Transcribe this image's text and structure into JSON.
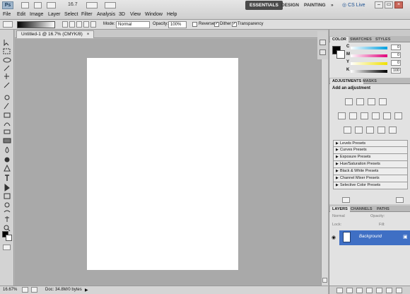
{
  "app": {
    "logo": "Ps",
    "zoom": "16.7",
    "workspaces": [
      "ESSENTIALS",
      "DESIGN",
      "PAINTING"
    ],
    "workspace_more": "»",
    "cs_live": "CS Live",
    "window_buttons": [
      "–",
      "▭",
      "×"
    ]
  },
  "menu": [
    "File",
    "Edit",
    "Image",
    "Layer",
    "Select",
    "Filter",
    "Analysis",
    "3D",
    "View",
    "Window",
    "Help"
  ],
  "options_bar": {
    "mode_label": "Mode:",
    "mode_value": "Normal",
    "opacity_label": "Opacity:",
    "opacity_value": "100%",
    "reverse_label": "Reverse",
    "dither_label": "Dither",
    "transparency_label": "Transparency",
    "reverse_checked": false,
    "dither_checked": true,
    "transparency_checked": true
  },
  "document": {
    "tab_title": "Untitled-1 @ 16.7% (CMYK/8)",
    "tab_close": "×"
  },
  "status": {
    "zoom": "16.67%",
    "doc_info": "Doc: 34.8M/0 bytes"
  },
  "panels": {
    "color_tabs": [
      "COLOR",
      "SWATCHES",
      "STYLES"
    ],
    "color_channels": [
      {
        "label": "C",
        "value": "0"
      },
      {
        "label": "M",
        "value": "0"
      },
      {
        "label": "Y",
        "value": "0"
      },
      {
        "label": "K",
        "value": "100"
      }
    ],
    "adjust_tabs": [
      "ADJUSTMENTS",
      "MASKS"
    ],
    "adjust_title": "Add an adjustment",
    "presets": [
      "Levels Presets",
      "Curves Presets",
      "Exposure Presets",
      "Hue/Saturation Presets",
      "Black & White Presets",
      "Channel Mixer Presets",
      "Selective Color Presets"
    ],
    "layers_tabs": [
      "LAYERS",
      "CHANNELS",
      "PATHS"
    ],
    "layers_blend": "Normal",
    "layers_opacity_label": "Opacity:",
    "layers_lock_label": "Lock:",
    "layers_fill_label": "Fill:",
    "layer_name": "Background"
  },
  "colors": {
    "accent": "#3f6fc4",
    "workspace_active": "#4a4a4a",
    "canvas_bg": "#a9a9a9"
  }
}
